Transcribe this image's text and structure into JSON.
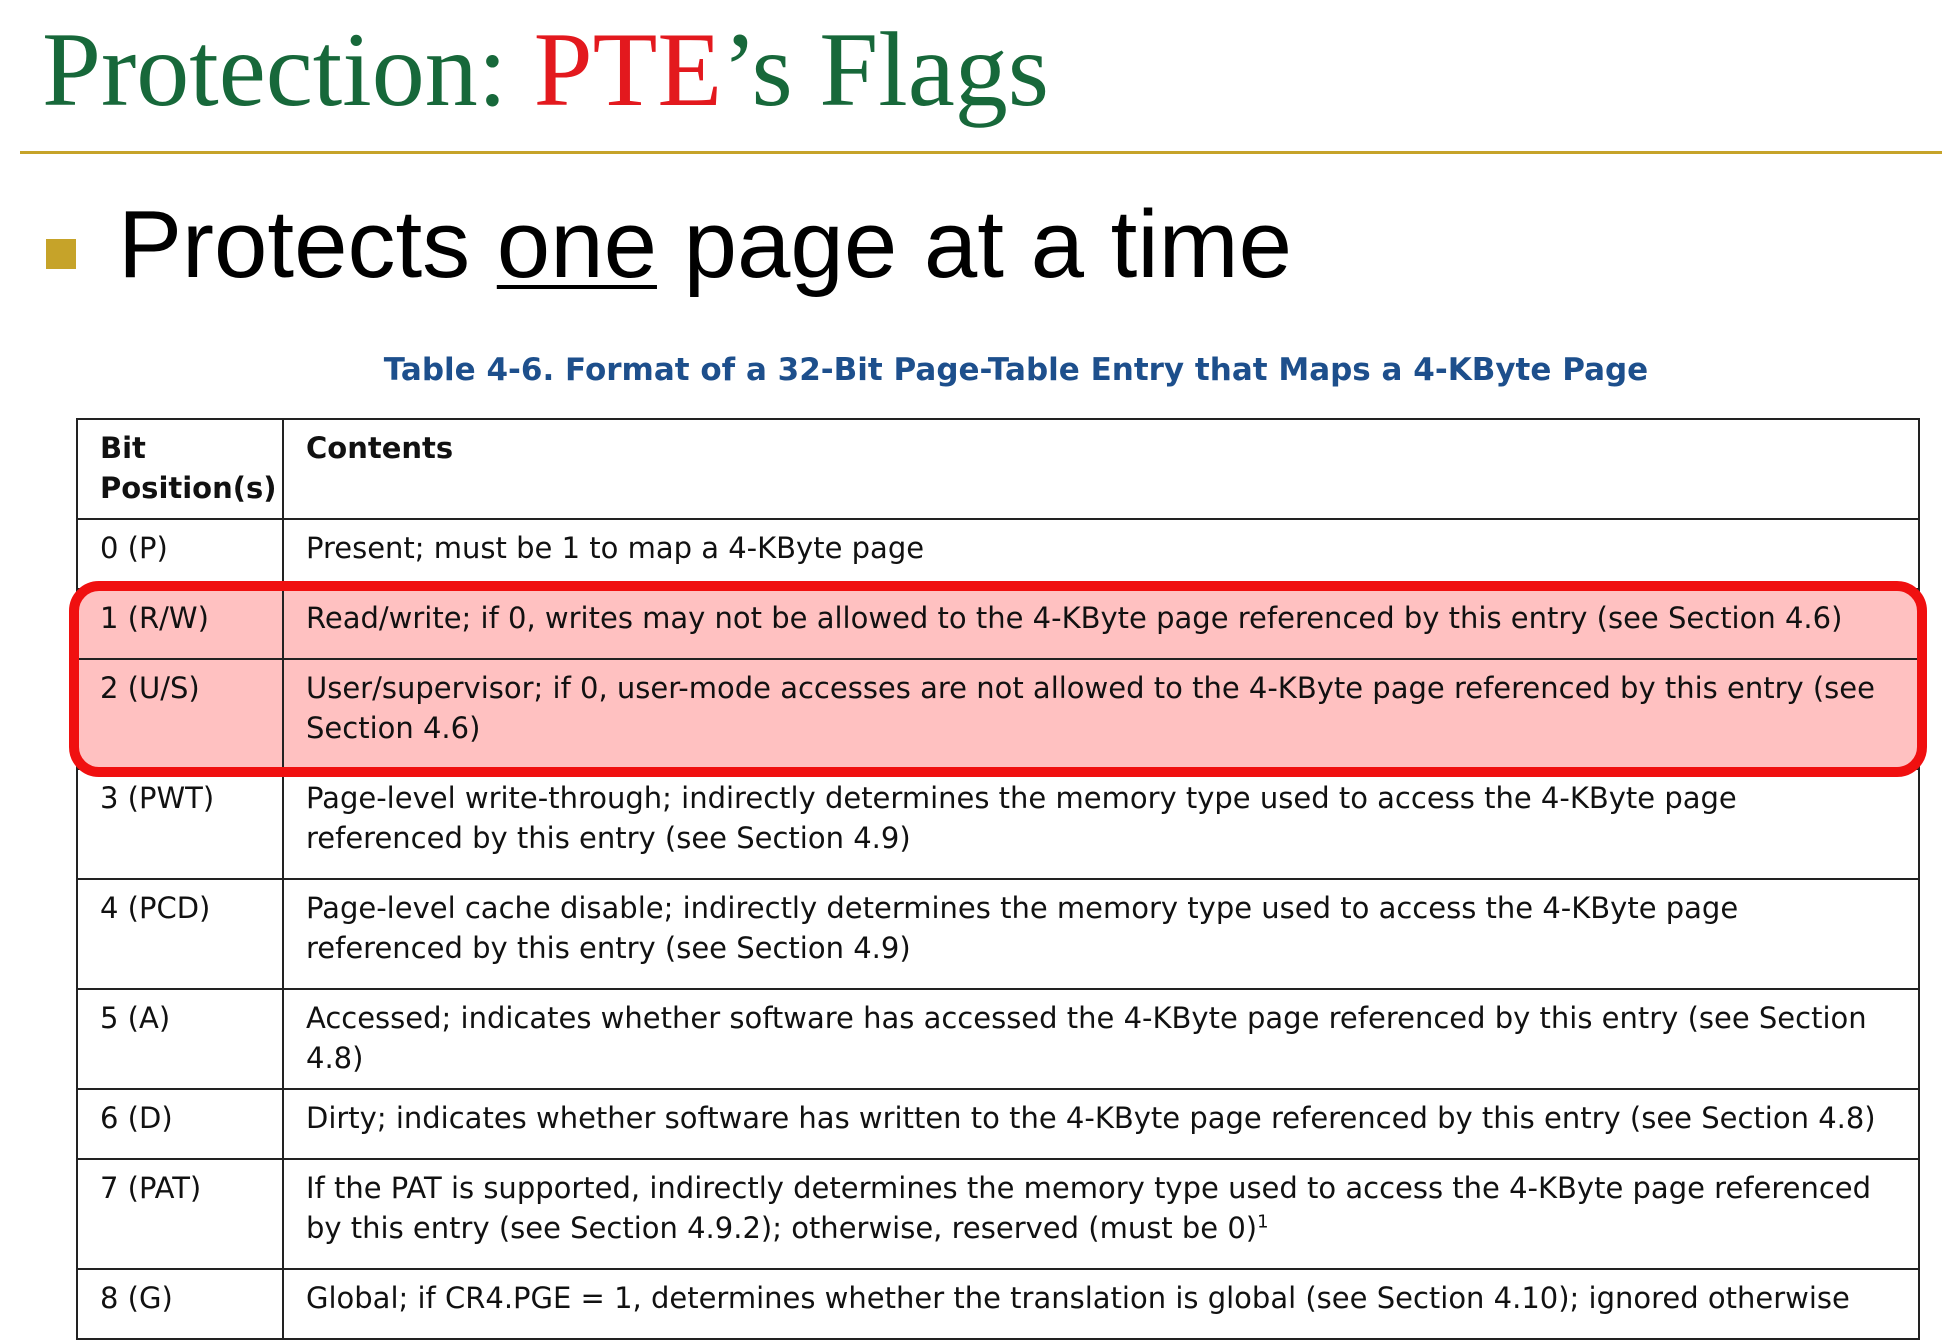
{
  "slide": {
    "title_prefix": "Protection: ",
    "title_pte": "PTE",
    "title_suffix": "’s Flags",
    "bullet_before": "Protects ",
    "bullet_underlined": "one",
    "bullet_after": " page at a time"
  },
  "colors": {
    "title_green": "#17683a",
    "title_red": "#e3191e",
    "rule_gold": "#c6a329",
    "caption_blue": "#1d4f8c",
    "highlight_fill": "#ffc1c1",
    "highlight_border": "#f01010"
  },
  "table": {
    "caption": "Table 4-6.  Format of a 32-Bit Page-Table Entry that Maps a 4-KByte Page",
    "headers": {
      "col1_line1": "Bit",
      "col1_line2": "Position(s)",
      "col2": "Contents"
    },
    "rows": [
      {
        "bit": "0 (P)",
        "contents": "Present; must be 1 to map a 4-KByte page"
      },
      {
        "bit": "1 (R/W)",
        "contents": "Read/write; if 0, writes may not be allowed to the 4-KByte page referenced by this entry (see Section 4.6)"
      },
      {
        "bit": "2 (U/S)",
        "contents": "User/supervisor; if 0, user-mode accesses are not allowed to the 4-KByte page referenced by this entry (see Section 4.6)"
      },
      {
        "bit": "3 (PWT)",
        "contents": "Page-level write-through; indirectly determines the memory type used to access the 4-KByte page referenced by this entry (see Section 4.9)"
      },
      {
        "bit": "4 (PCD)",
        "contents": "Page-level cache disable; indirectly determines the memory type used to access the 4-KByte page referenced by this entry (see Section 4.9)"
      },
      {
        "bit": "5 (A)",
        "contents": "Accessed; indicates whether software has accessed the 4-KByte page referenced by this entry (see Section 4.8)"
      },
      {
        "bit": "6 (D)",
        "contents": "Dirty; indicates whether software has written to the 4-KByte page referenced by this entry (see Section 4.8)"
      },
      {
        "bit": "7 (PAT)",
        "contents": "If the PAT is supported, indirectly determines the memory type used to access the 4-KByte page referenced by this entry (see Section 4.9.2); otherwise, reserved (must be 0)",
        "footnote": "1"
      },
      {
        "bit": "8 (G)",
        "contents": "Global; if CR4.PGE = 1, determines whether the translation is global (see Section 4.10); ignored otherwise"
      }
    ]
  }
}
